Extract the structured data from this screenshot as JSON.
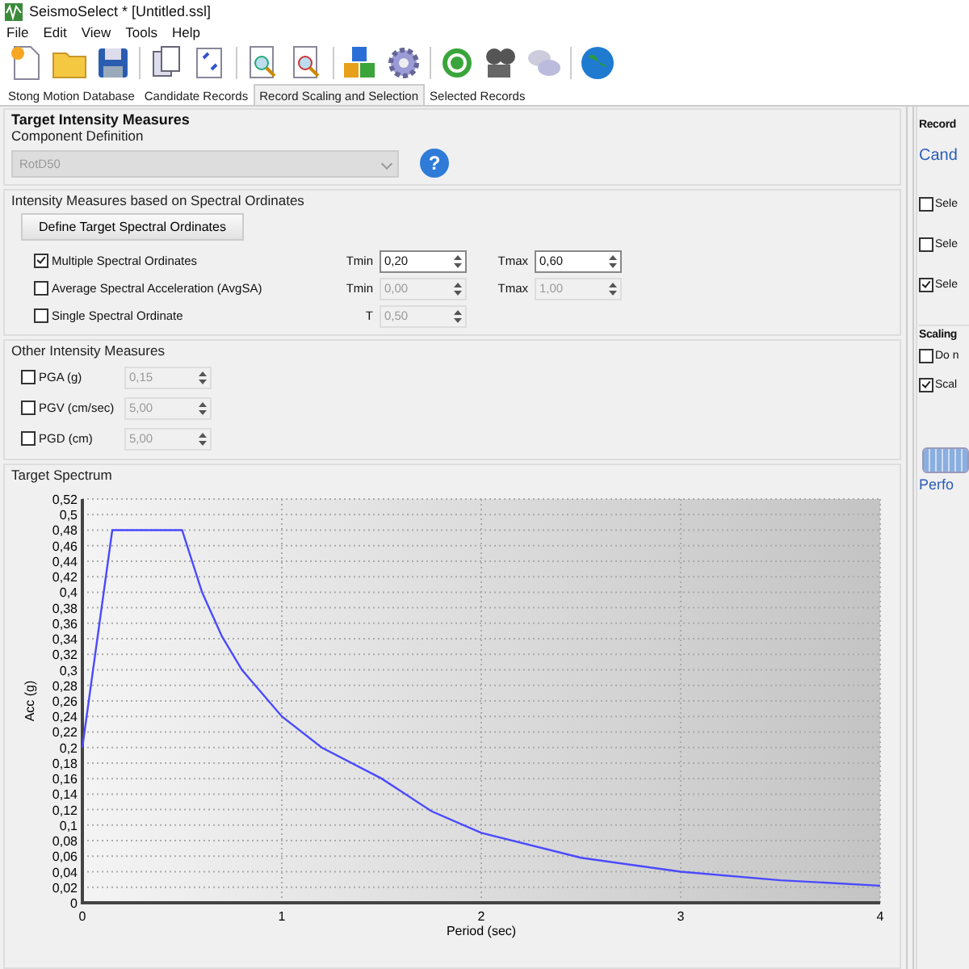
{
  "window": {
    "title": "SeismoSelect * [Untitled.ssl]"
  },
  "menu": [
    "File",
    "Edit",
    "View",
    "Tools",
    "Help"
  ],
  "tabs": [
    {
      "label": "Stong Motion Database",
      "selected": false
    },
    {
      "label": "Candidate Records",
      "selected": false
    },
    {
      "label": "Record Scaling and Selection",
      "selected": true
    },
    {
      "label": "Selected Records",
      "selected": false
    }
  ],
  "target": {
    "title": "Target Intensity Measures",
    "component_label": "Component Definition",
    "component_value": "RotD50",
    "help_glyph": "?",
    "spectral": {
      "title": "Intensity Measures based on Spectral Ordinates",
      "button": "Define Target Spectral Ordinates",
      "rows": [
        {
          "label": "Multiple Spectral Ordinates",
          "checked": true,
          "fields": [
            {
              "label": "Tmin",
              "value": "0,20",
              "disabled": false
            },
            {
              "label": "Tmax",
              "value": "0,60",
              "disabled": false
            }
          ]
        },
        {
          "label": "Average Spectral Acceleration (AvgSA)",
          "checked": false,
          "fields": [
            {
              "label": "Tmin",
              "value": "0,00",
              "disabled": true
            },
            {
              "label": "Tmax",
              "value": "1,00",
              "disabled": true
            }
          ]
        },
        {
          "label": "Single Spectral Ordinate",
          "checked": false,
          "fields": [
            {
              "label": "T",
              "value": "0,50",
              "disabled": true
            }
          ]
        }
      ]
    },
    "other": {
      "title": "Other Intensity Measures",
      "rows": [
        {
          "label": "PGA (g)",
          "checked": false,
          "value": "0,15"
        },
        {
          "label": "PGV (cm/sec)",
          "checked": false,
          "value": "5,00"
        },
        {
          "label": "PGD (cm)",
          "checked": false,
          "value": "5,00"
        }
      ]
    },
    "spectrum": {
      "title": "Target Spectrum",
      "chart_data": {
        "type": "line",
        "xlabel": "Period (sec)",
        "ylabel": "Acc (g)",
        "x": [
          0,
          0.15,
          0.5,
          0.6,
          0.7,
          0.8,
          1,
          1.2,
          1.5,
          1.75,
          2,
          2.5,
          3,
          3.5,
          4
        ],
        "grid": true,
        "series": [
          {
            "color": "#4a4aff",
            "values": [
              0.2,
              0.48,
              0.48,
              0.4,
              0.343,
              0.3,
              0.24,
              0.2,
              0.16,
              0.118,
              0.09,
              0.058,
              0.04,
              0.029,
              0.022
            ]
          }
        ],
        "xlim": [
          0,
          4
        ],
        "ylim": [
          0,
          0.52
        ],
        "xticks": [
          0,
          1,
          2,
          3,
          4
        ],
        "yticks": [
          {
            "value": 0,
            "label": "0"
          },
          {
            "value": 0.02,
            "label": "0,02"
          },
          {
            "value": 0.04,
            "label": "0,04"
          },
          {
            "value": 0.06,
            "label": "0,06"
          },
          {
            "value": 0.08,
            "label": "0,08"
          },
          {
            "value": 0.1,
            "label": "0,1"
          },
          {
            "value": 0.12,
            "label": "0,12"
          },
          {
            "value": 0.14,
            "label": "0,14"
          },
          {
            "value": 0.16,
            "label": "0,16"
          },
          {
            "value": 0.18,
            "label": "0,18"
          },
          {
            "value": 0.2,
            "label": "0,2"
          },
          {
            "value": 0.22,
            "label": "0,22"
          },
          {
            "value": 0.24,
            "label": "0,24"
          },
          {
            "value": 0.26,
            "label": "0,26"
          },
          {
            "value": 0.28,
            "label": "0,28"
          },
          {
            "value": 0.3,
            "label": "0,3"
          },
          {
            "value": 0.32,
            "label": "0,32"
          },
          {
            "value": 0.34,
            "label": "0,34"
          },
          {
            "value": 0.36,
            "label": "0,36"
          },
          {
            "value": 0.38,
            "label": "0,38"
          },
          {
            "value": 0.4,
            "label": "0,4"
          },
          {
            "value": 0.42,
            "label": "0,42"
          },
          {
            "value": 0.44,
            "label": "0,44"
          },
          {
            "value": 0.46,
            "label": "0,46"
          },
          {
            "value": 0.48,
            "label": "0,48"
          },
          {
            "value": 0.5,
            "label": "0,5"
          },
          {
            "value": 0.52,
            "label": "0,52"
          }
        ]
      }
    }
  },
  "right_panel": {
    "title": "Record",
    "link": "Cand",
    "options": [
      {
        "label": "Sele",
        "checked": false
      },
      {
        "label": "Sele",
        "checked": false
      },
      {
        "label": "Sele",
        "checked": true
      }
    ],
    "scaling_title": "Scaling",
    "scaling_options": [
      {
        "label": "Do n",
        "checked": false
      },
      {
        "label": "Scal",
        "checked": true
      }
    ],
    "progress": {
      "level": 1
    },
    "progress_label": "Perfo"
  }
}
